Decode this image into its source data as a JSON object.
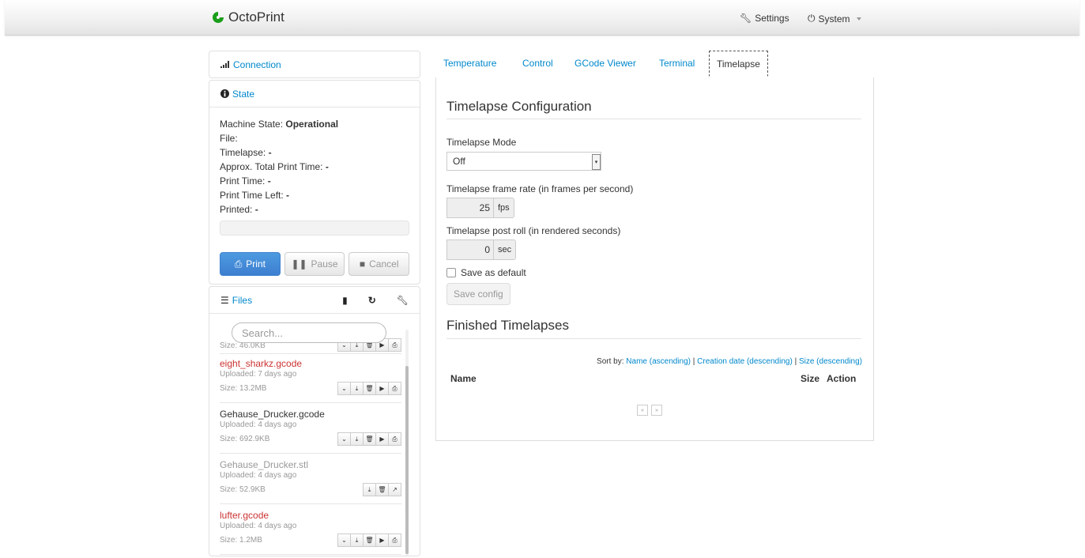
{
  "app": {
    "brand": "OctoPrint",
    "accent": "#0088cc"
  },
  "navbar": {
    "settings": "Settings",
    "system": "System"
  },
  "sidebar": {
    "connection": "Connection",
    "state": {
      "title": "State",
      "lines": [
        {
          "label": "Machine State: ",
          "value": "Operational"
        },
        {
          "label": "File: ",
          "value": ""
        },
        {
          "label": "Timelapse: ",
          "value": "-"
        },
        {
          "label": "Approx. Total Print Time: ",
          "value": "-"
        },
        {
          "label": "Print Time: ",
          "value": "-"
        },
        {
          "label": "Print Time Left: ",
          "value": "-"
        },
        {
          "label": "Printed: ",
          "value": "-"
        }
      ],
      "progress": 0,
      "buttons": {
        "print": "Print",
        "pause": "Pause",
        "cancel": "Cancel"
      }
    },
    "files": {
      "title": "Files",
      "search_placeholder": "Search...",
      "items": [
        {
          "name": "",
          "uploaded": "",
          "size": "Size: 46.0KB",
          "status": "partial"
        },
        {
          "name": "eight_sharkz.gcode",
          "uploaded": "Uploaded: 7 days ago",
          "size": "Size: 13.2MB",
          "status": "red"
        },
        {
          "name": "Gehause_Drucker.gcode",
          "uploaded": "Uploaded: 4 days ago",
          "size": "Size: 692.9KB",
          "status": "normal"
        },
        {
          "name": "Gehause_Drucker.stl",
          "uploaded": "Uploaded: 4 days ago",
          "size": "Size: 52.9KB",
          "status": "muted"
        },
        {
          "name": "lufter.gcode",
          "uploaded": "Uploaded: 4 days ago",
          "size": "Size: 1.2MB",
          "status": "red"
        }
      ]
    }
  },
  "tabs": [
    "Temperature",
    "Control",
    "GCode Viewer",
    "Terminal",
    "Timelapse"
  ],
  "timelapse": {
    "config_title": "Timelapse Configuration",
    "mode_label": "Timelapse Mode",
    "mode_value": "Off",
    "fps_label": "Timelapse frame rate (in frames per second)",
    "fps_value": "25",
    "fps_unit": "fps",
    "postroll_label": "Timelapse post roll (in rendered seconds)",
    "postroll_value": "0",
    "postroll_unit": "sec",
    "save_default": "Save as default",
    "save_config": "Save config",
    "finished_title": "Finished Timelapses",
    "sort_prefix": "Sort by: ",
    "sort_name": "Name (ascending)",
    "sort_sep": " | ",
    "sort_date": "Creation date (descending)",
    "sort_size": "Size (descending)",
    "col_name": "Name",
    "col_size": "Size",
    "col_action": "Action",
    "pager_prev": "«",
    "pager_next": "»"
  }
}
